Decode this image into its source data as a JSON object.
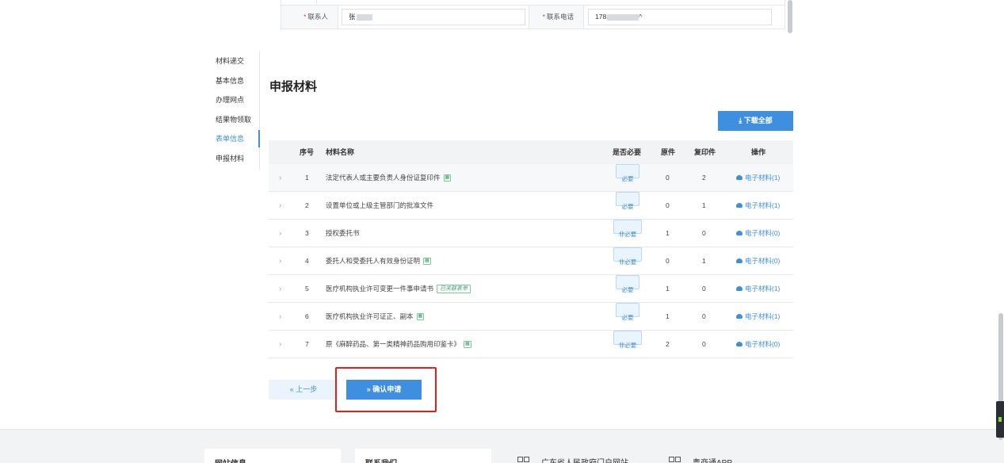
{
  "contact": {
    "person_label": "联系人",
    "person_value": "张",
    "phone_label": "联系电话",
    "phone_value": "178",
    "phone_suffix": "^"
  },
  "sidenav": {
    "items": [
      {
        "label": "材料递交"
      },
      {
        "label": "基本信息"
      },
      {
        "label": "办理网点"
      },
      {
        "label": "结果物领取"
      },
      {
        "label": "表单信息"
      },
      {
        "label": "申报材料"
      }
    ],
    "active_index": 4
  },
  "section_title": "申报材料",
  "download_all": "下载全部",
  "table": {
    "headers": {
      "index": "序号",
      "name": "材料名称",
      "required": "是否必要",
      "original": "原件",
      "copy": "复印件",
      "action": "操作"
    },
    "rows": [
      {
        "index": "1",
        "name": "法定代表人或主要负责人身份证复印件",
        "tag": "ocr",
        "required": "必要",
        "original": "0",
        "copy": "2",
        "action": "电子材料(1)"
      },
      {
        "index": "2",
        "name": "设置单位或上级主管部门的批准文件",
        "tag": "",
        "required": "必要",
        "original": "0",
        "copy": "1",
        "action": "电子材料(1)"
      },
      {
        "index": "3",
        "name": "授权委托书",
        "tag": "",
        "required": "非必要",
        "original": "1",
        "copy": "0",
        "action": "电子材料(0)"
      },
      {
        "index": "4",
        "name": "委托人和受委托人有效身份证明",
        "tag": "ocr",
        "required": "非必要",
        "original": "0",
        "copy": "1",
        "action": "电子材料(0)"
      },
      {
        "index": "5",
        "name": "医疗机构执业许可变更一件事申请书",
        "tag": "form",
        "tag_text": "已关联表单",
        "required": "必要",
        "original": "1",
        "copy": "0",
        "action": "电子材料(1)"
      },
      {
        "index": "6",
        "name": "医疗机构执业许可证正、副本",
        "tag": "ocr",
        "required": "必要",
        "original": "1",
        "copy": "0",
        "action": "电子材料(1)"
      },
      {
        "index": "7",
        "name": "原《麻醉药品、第一类精神药品购用印鉴卡》",
        "tag": "ocr",
        "required": "非必要",
        "original": "2",
        "copy": "0",
        "action": "电子材料(0)"
      }
    ]
  },
  "buttons": {
    "prev": "« 上一步",
    "confirm": "» 确认申请"
  },
  "footer": {
    "cards": [
      {
        "label": "网站信息"
      },
      {
        "label": "联系我们"
      },
      {
        "label": "广东省人民政府门户网站"
      },
      {
        "label": "粤商通APP"
      }
    ]
  }
}
